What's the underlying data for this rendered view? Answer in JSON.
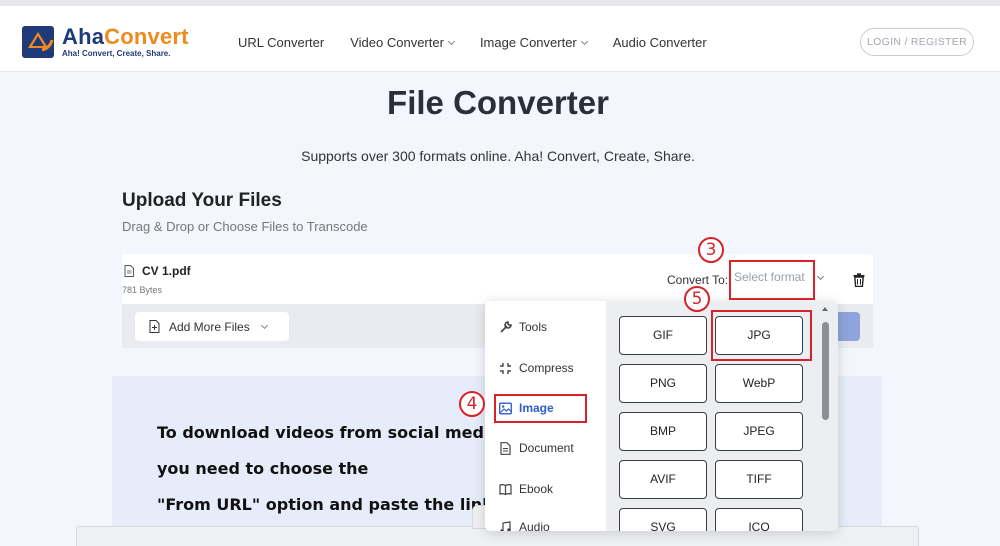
{
  "header": {
    "logo": {
      "name_part1": "Aha",
      "name_part2": "Convert",
      "tagline": "Aha! Convert, Create, Share."
    },
    "nav": [
      {
        "label": "URL Converter",
        "dropdown": false
      },
      {
        "label": "Video Converter",
        "dropdown": true
      },
      {
        "label": "Image Converter",
        "dropdown": true
      },
      {
        "label": "Audio Converter",
        "dropdown": false
      }
    ],
    "login_label": "LOGIN / REGISTER"
  },
  "main": {
    "title": "File Converter",
    "subtitle": "Supports over 300 formats online. Aha! Convert, Create, Share.",
    "upload_title": "Upload Your Files",
    "upload_subtitle": "Drag & Drop or Choose Files to Transcode"
  },
  "file": {
    "name": "CV 1.pdf",
    "size": "781 Bytes",
    "convert_to_label": "Convert To:",
    "select_placeholder": "Select format"
  },
  "actions": {
    "add_more_label": "Add More Files"
  },
  "dropdown": {
    "categories": [
      {
        "label": "Tools",
        "icon": "wrench-icon",
        "active": false
      },
      {
        "label": "Compress",
        "icon": "compress-icon",
        "active": false
      },
      {
        "label": "Image",
        "icon": "image-icon",
        "active": true
      },
      {
        "label": "Document",
        "icon": "document-icon",
        "active": false
      },
      {
        "label": "Ebook",
        "icon": "book-icon",
        "active": false
      },
      {
        "label": "Audio",
        "icon": "audio-icon",
        "active": false
      }
    ],
    "formats": [
      "GIF",
      "JPG",
      "PNG",
      "WebP",
      "BMP",
      "JPEG",
      "AVIF",
      "TIFF",
      "SVG",
      "ICO"
    ]
  },
  "promo": {
    "lines": [
      "To download videos from social media platforms,",
      "you need to choose the",
      "\"From URL\" option and paste the link"
    ]
  },
  "annotations": {
    "steps": [
      "3",
      "4",
      "5"
    ]
  },
  "colors": {
    "accent": "#2f5bd1",
    "brand_blue": "#1f3a78",
    "brand_orange": "#f08a1c",
    "annotation_red": "#d6232a"
  }
}
